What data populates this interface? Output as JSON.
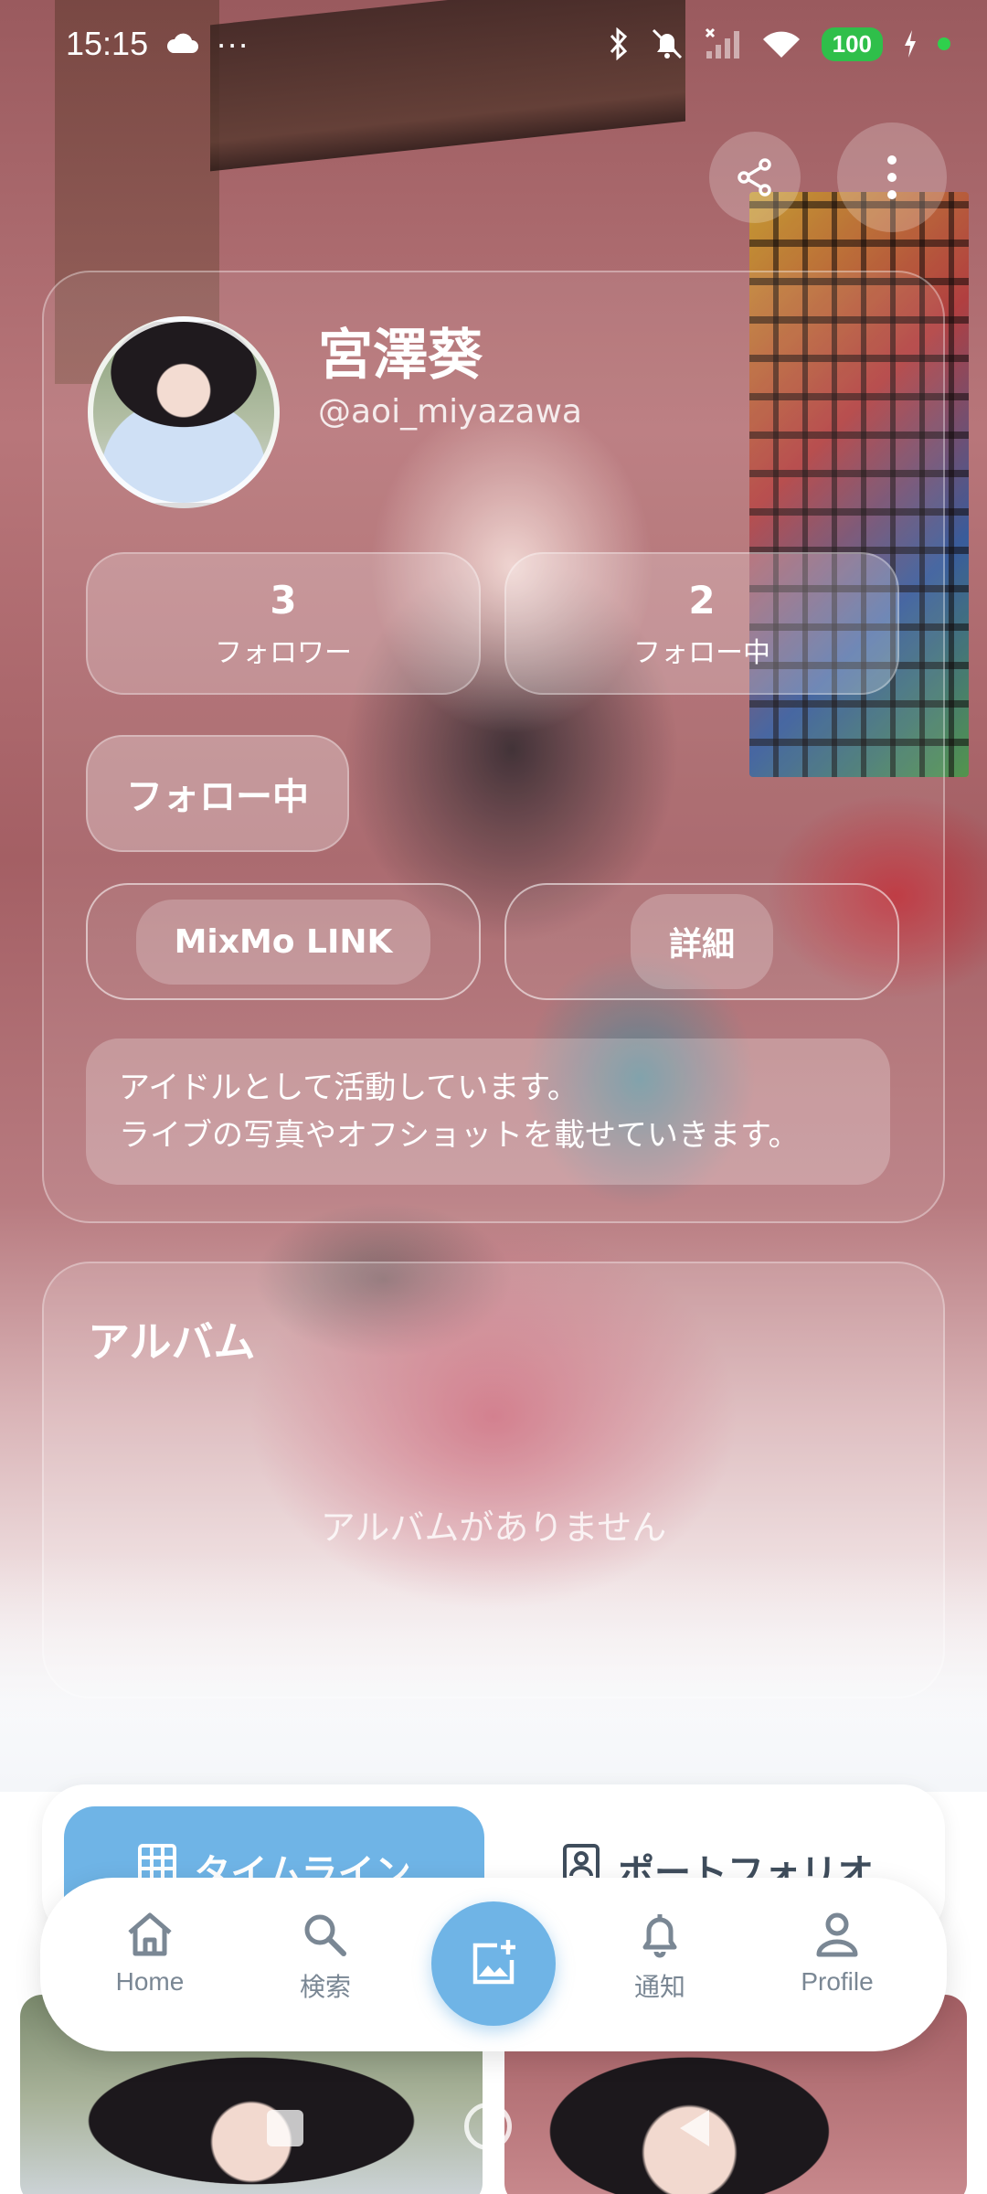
{
  "status_bar": {
    "time": "15:15",
    "dots": "···",
    "battery": "100"
  },
  "profile": {
    "display_name": "宮澤葵",
    "handle": "@aoi_miyazawa",
    "followers_count": "3",
    "followers_label": "フォロワー",
    "following_count": "2",
    "following_label": "フォロー中",
    "follow_button": "フォロー中",
    "link_button": "MixMo LINK",
    "details_button": "詳細",
    "bio_line1": "アイドルとして活動しています。",
    "bio_line2": "ライブの写真やオフショットを載せていきます。"
  },
  "album": {
    "title": "アルバム",
    "empty_text": "アルバムがありません"
  },
  "tabs": [
    {
      "label": "タイムライン",
      "icon": "grid-icon",
      "active": true
    },
    {
      "label": "ポートフォリオ",
      "icon": "portfolio-icon",
      "active": false
    }
  ],
  "bottom_nav": [
    {
      "label": "Home",
      "icon": "home-icon"
    },
    {
      "label": "検索",
      "icon": "search-icon"
    },
    {
      "label": "",
      "icon": "add-photo-icon"
    },
    {
      "label": "通知",
      "icon": "bell-icon"
    },
    {
      "label": "Profile",
      "icon": "person-icon"
    }
  ],
  "colors": {
    "accent": "#6fb4e6",
    "nav_text": "#7a8794",
    "battery": "#2fbf4a"
  }
}
